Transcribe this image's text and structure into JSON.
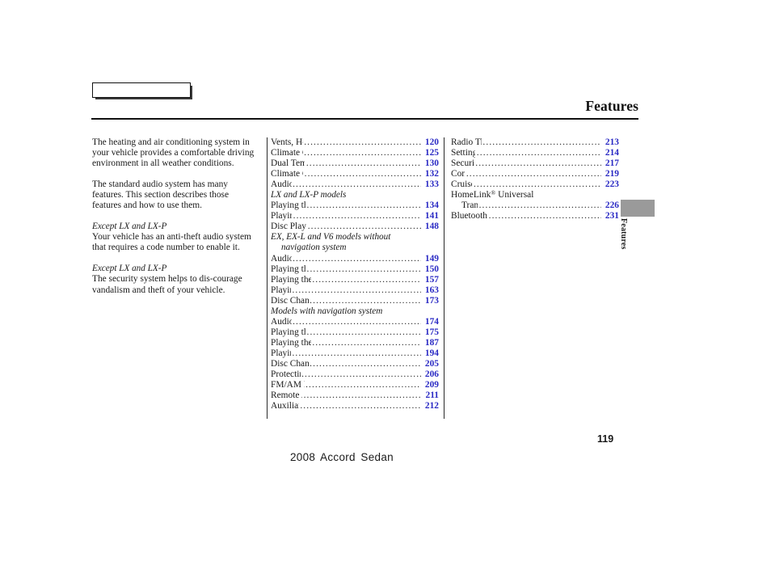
{
  "header": {
    "title": "Features",
    "tab_box_empty": true
  },
  "intro": {
    "paragraphs": [
      "The heating and air conditioning system in your vehicle provides a comfortable driving environment in all weather conditions.",
      "The standard audio system has many features. This section describes those features and how to use them."
    ],
    "sections": [
      {
        "heading": "Except LX and LX-P",
        "body": "Your vehicle has an anti-theft audio system that requires a code number to enable it."
      },
      {
        "heading": "Except LX and LX-P",
        "body": "The security system helps to dis-courage vandalism and theft of your vehicle."
      }
    ]
  },
  "toc_middle": [
    {
      "type": "entry",
      "label": "Vents, Heating, and A/C",
      "page": "120"
    },
    {
      "type": "entry",
      "label": "Climate Control System",
      "page": "125"
    },
    {
      "type": "entry",
      "label": "Dual Temperature Control",
      "page": "130"
    },
    {
      "type": "entry",
      "label": "Climate Control Sensors",
      "page": "132"
    },
    {
      "type": "entry",
      "label": "Audio System",
      "page": "133"
    },
    {
      "type": "italic",
      "label": "LX and LX-P models"
    },
    {
      "type": "entry",
      "label": "Playing the FM/AM Radio",
      "page": "134"
    },
    {
      "type": "entry",
      "label": "Playing a Disc",
      "page": "141"
    },
    {
      "type": "entry",
      "label": "Disc Player Error Messages",
      "page": "148"
    },
    {
      "type": "italic",
      "label": "EX, EX-L and V6 models without"
    },
    {
      "type": "italic-cont",
      "label": "navigation system"
    },
    {
      "type": "entry",
      "label": "Audio System",
      "page": "149"
    },
    {
      "type": "entry",
      "label": "Playing the FM/AM Radio",
      "page": "150"
    },
    {
      "type": "entry",
      "label": "Playing the XM® Satellite Radio",
      "page": "157",
      "reg_after": "XM"
    },
    {
      "type": "entry",
      "label": "Playing Discs",
      "page": "163"
    },
    {
      "type": "entry",
      "label": "Disc Changer Error Messages",
      "page": "173"
    },
    {
      "type": "italic",
      "label": "Models with navigation system"
    },
    {
      "type": "entry",
      "label": "Audio System",
      "page": "174"
    },
    {
      "type": "entry",
      "label": "Playing the FM/AM Radio",
      "page": "175"
    },
    {
      "type": "entry",
      "label": "Playing the XM® Satellite Radio",
      "page": "187",
      "reg_after": "XM"
    },
    {
      "type": "entry",
      "label": "Playing Discs",
      "page": "194"
    },
    {
      "type": "entry",
      "label": "Disc Changer Error Messages",
      "page": "205"
    },
    {
      "type": "entry",
      "label": "Protecting Your Discs",
      "page": "206"
    },
    {
      "type": "entry",
      "label": "FM/AM Radio Reception",
      "page": "209"
    },
    {
      "type": "entry",
      "label": "Remote Audio Controls",
      "page": "211"
    },
    {
      "type": "entry",
      "label": "Auxiliary Input Jack",
      "page": "212"
    }
  ],
  "toc_right": [
    {
      "type": "entry",
      "label": "Radio Theft Protection",
      "page": "213"
    },
    {
      "type": "entry",
      "label": "Setting the Clock",
      "page": "214"
    },
    {
      "type": "entry",
      "label": "Security System",
      "page": "217"
    },
    {
      "type": "entry",
      "label": "Compass",
      "page": "219"
    },
    {
      "type": "entry",
      "label": "Cruise Control",
      "page": "223"
    },
    {
      "type": "plain",
      "label": "HomeLink® Universal"
    },
    {
      "type": "entry-wrapped",
      "label": "Transceiver",
      "page": "226"
    },
    {
      "type": "entry",
      "label": "Bluetooth® HandsFreeLink®",
      "page": "231"
    }
  ],
  "side_tab": {
    "label": "Features",
    "color": "#9a9a9a"
  },
  "footer": {
    "page_number": "119",
    "title": "2008  Accord  Sedan"
  },
  "colors": {
    "page_number_blue": "#2a2ac4",
    "text": "#1a1a1a",
    "rule": "#111111"
  }
}
